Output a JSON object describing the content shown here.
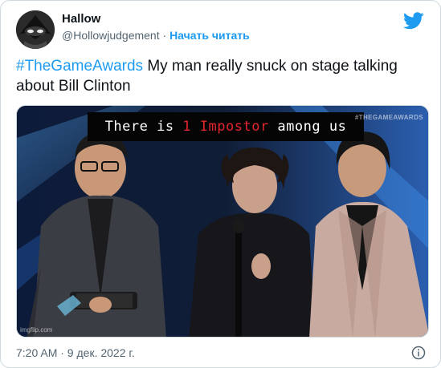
{
  "author": {
    "display_name": "Hallow",
    "handle": "@Hollowjudgement",
    "separator": "·",
    "follow_label": "Начать читать"
  },
  "tweet": {
    "hashtag": "#TheGameAwards",
    "text": " My man really snuck on stage talking about Bill Clinton"
  },
  "media": {
    "caption_part1": "There is ",
    "caption_number": "1",
    "caption_space": " ",
    "caption_red": "Impostor",
    "caption_part2": " among us",
    "watermark": "#THEGAMEAWARDS",
    "credit": "imgflip.com"
  },
  "footer": {
    "timestamp": "7:20 AM · 9 дек. 2022 г."
  },
  "colors": {
    "accent": "#1d9bf0",
    "caption_red": "#e3262e",
    "text_secondary": "#536471"
  },
  "icons": {
    "logo": "twitter-bird-icon",
    "info": "info-icon"
  }
}
